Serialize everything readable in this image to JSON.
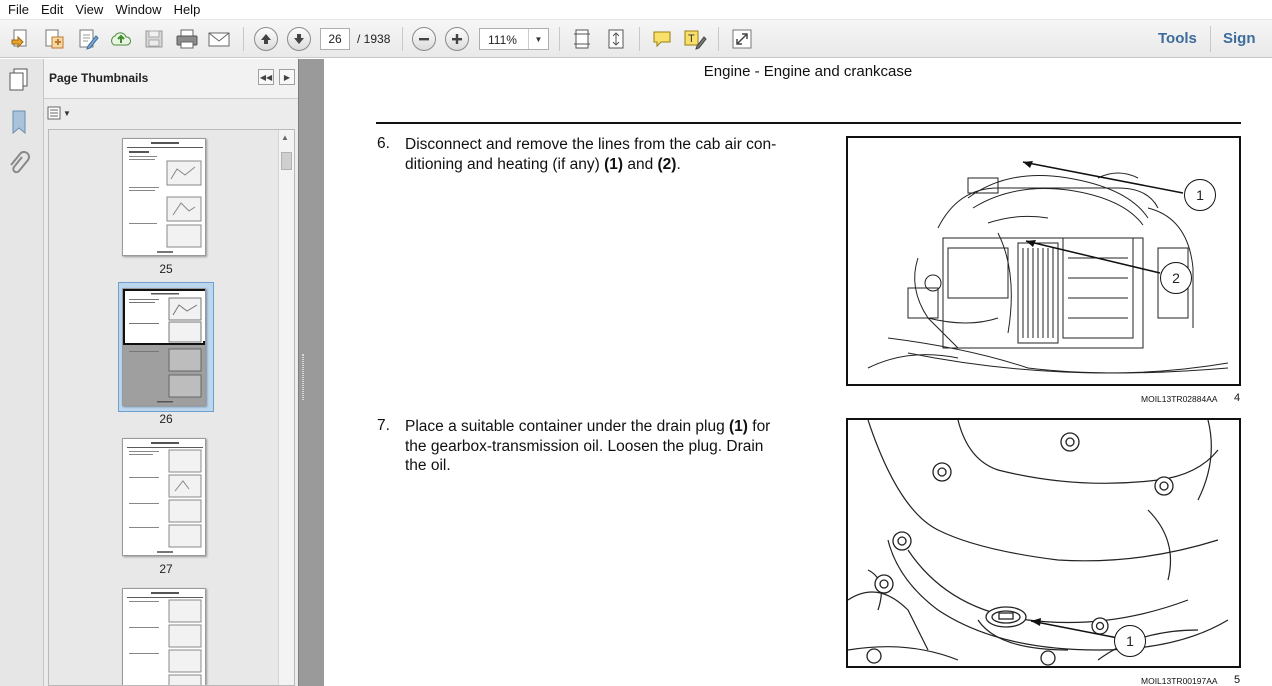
{
  "menu": [
    "File",
    "Edit",
    "View",
    "Window",
    "Help"
  ],
  "toolbar": {
    "page_current": "26",
    "page_total": "/ 1938",
    "zoom": "111%",
    "tools_label": "Tools",
    "sign_label": "Sign"
  },
  "panel": {
    "title": "Page Thumbnails",
    "thumbnails": [
      {
        "page": "25"
      },
      {
        "page": "26"
      },
      {
        "page": "27"
      },
      {
        "page": ""
      }
    ]
  },
  "document": {
    "header": "Engine - Engine and crankcase",
    "steps": [
      {
        "number": "6.",
        "line1": "Disconnect and remove the lines from the cab air con-",
        "line2_pre": "ditioning and heating (if any) ",
        "bold1": "(1)",
        "mid": " and ",
        "bold2": "(2)",
        "end": "."
      },
      {
        "number": "7.",
        "line1_pre": "Place a suitable container under the drain plug ",
        "bold1": "(1)",
        "line1_post": " for",
        "line2": "the gearbox-transmission oil.  Loosen the plug.  Drain",
        "line3": "the oil."
      }
    ],
    "figures": [
      {
        "ref": "MOIL13TR02884AA",
        "number": "4",
        "callouts": [
          "1",
          "2"
        ]
      },
      {
        "ref": "MOIL13TR00197AA",
        "number": "5",
        "callouts": [
          "1"
        ]
      }
    ]
  }
}
